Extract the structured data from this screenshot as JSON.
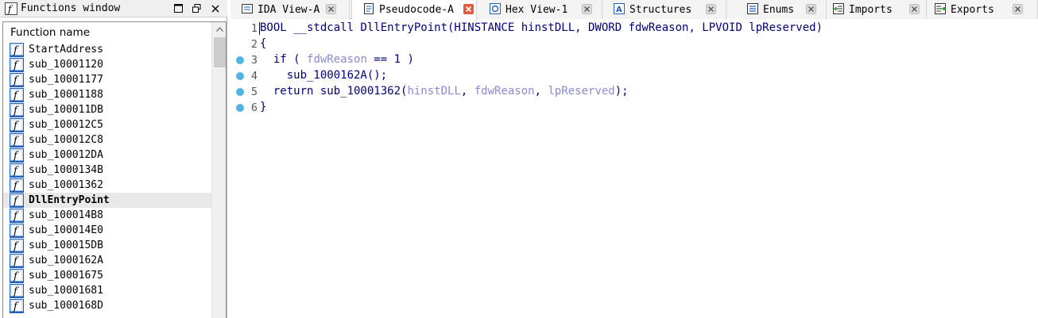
{
  "functions_window": {
    "title": "Functions window",
    "column_header": "Function name",
    "selected_index": 10,
    "functions": [
      "StartAddress",
      "sub_10001120",
      "sub_10001177",
      "sub_10001188",
      "sub_100011DB",
      "sub_100012C5",
      "sub_100012C8",
      "sub_100012DA",
      "sub_1000134B",
      "sub_10001362",
      "DllEntryPoint",
      "sub_100014B8",
      "sub_100014E0",
      "sub_100015DB",
      "sub_1000162A",
      "sub_10001675",
      "sub_10001681",
      "sub_1000168D"
    ],
    "function_icon": "function-f-icon"
  },
  "tabs": [
    {
      "label": "IDA View-A",
      "icon": "ida-view-icon",
      "active": false
    },
    {
      "label": "Pseudocode-A",
      "icon": "pseudocode-icon",
      "active": true
    },
    {
      "label": "Hex View-1",
      "icon": "hex-view-icon",
      "active": false
    },
    {
      "label": "Structures",
      "icon": "structures-icon",
      "active": false
    },
    {
      "label": "Enums",
      "icon": "enums-icon",
      "active": false
    },
    {
      "label": "Imports",
      "icon": "imports-icon",
      "active": false
    },
    {
      "label": "Exports",
      "icon": "exports-icon",
      "active": false
    }
  ],
  "pseudocode": {
    "lines": [
      {
        "num": "1",
        "breakpoint": false,
        "tokens": [
          {
            "t": "BOOL __stdcall DllEntryPoint(HINSTANCE hinstDLL, DWORD fdwReason, LPVOID lpReserved)",
            "c": "k"
          }
        ]
      },
      {
        "num": "2",
        "breakpoint": false,
        "tokens": [
          {
            "t": "{",
            "c": "k"
          }
        ]
      },
      {
        "num": "3",
        "breakpoint": true,
        "tokens": [
          {
            "t": "  if ( ",
            "c": "k"
          },
          {
            "t": "fdwReason",
            "c": "v"
          },
          {
            "t": " == 1 )",
            "c": "k"
          }
        ]
      },
      {
        "num": "4",
        "breakpoint": true,
        "tokens": [
          {
            "t": "    sub_1000162A();",
            "c": "k"
          }
        ]
      },
      {
        "num": "5",
        "breakpoint": true,
        "tokens": [
          {
            "t": "  return sub_10001362(",
            "c": "k"
          },
          {
            "t": "hinstDLL",
            "c": "v"
          },
          {
            "t": ", ",
            "c": "k"
          },
          {
            "t": "fdwReason",
            "c": "v"
          },
          {
            "t": ", ",
            "c": "k"
          },
          {
            "t": "lpReserved",
            "c": "v"
          },
          {
            "t": ");",
            "c": "k"
          }
        ]
      },
      {
        "num": "6",
        "breakpoint": true,
        "tokens": [
          {
            "t": "}",
            "c": "k"
          }
        ]
      }
    ]
  },
  "colors": {
    "code_text": "#000080",
    "variable": "#8a8ad6",
    "breakpoint_dot": "#4db3e8",
    "icon_blue": "#1f5fbf"
  }
}
